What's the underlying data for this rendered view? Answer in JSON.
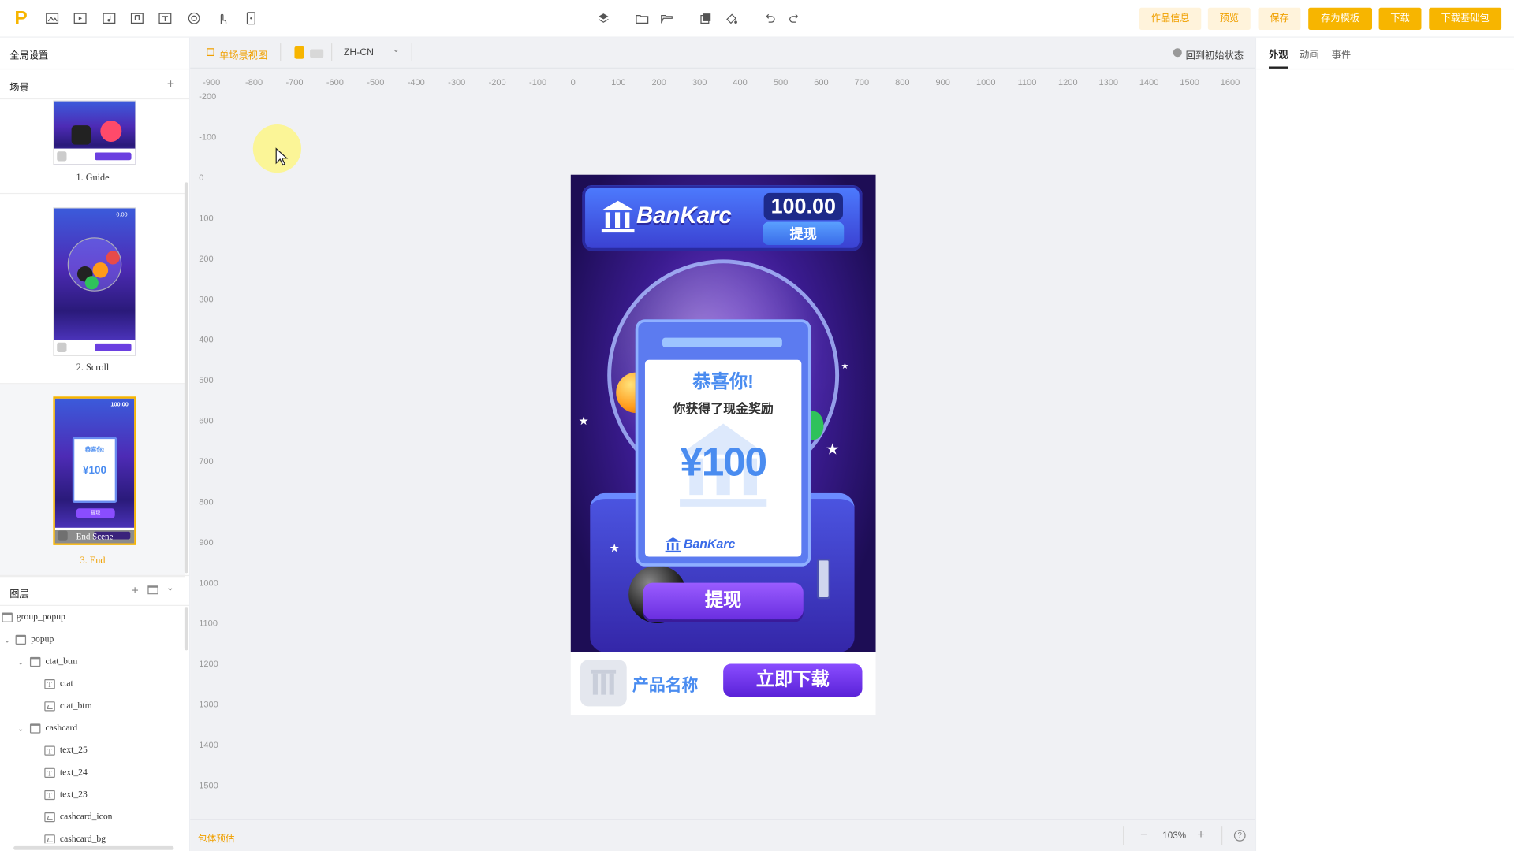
{
  "toolbar": {
    "left_icons": [
      "image-icon",
      "video-icon",
      "music-note-icon",
      "audio-icon",
      "text-icon",
      "target-icon",
      "gesture-icon",
      "phone-icon"
    ],
    "center_icons": [
      "layers-icon",
      "folder-icon",
      "folder-open-icon",
      "copy-icon",
      "paint-icon",
      "undo-icon",
      "redo-icon"
    ],
    "buttons": {
      "info": "作品信息",
      "preview": "预览",
      "save": "保存",
      "save_template": "存为模板",
      "download": "下载",
      "download_base": "下载基础包"
    },
    "accent": "#f7b500"
  },
  "left": {
    "global_settings": "全局设置",
    "scenes_title": "场景",
    "scenes": [
      {
        "label": "1. Guide"
      },
      {
        "label": "2. Scroll"
      },
      {
        "label": "3. End",
        "overlay": "End Scene"
      }
    ],
    "thumbs": {
      "scroll_balance": "0.00",
      "end_balance": "100.00",
      "end_congrats": "恭喜你!",
      "end_amount": "¥100",
      "end_withdraw": "提现"
    },
    "layers_title": "图层",
    "layers": [
      {
        "name": "group_popup"
      },
      {
        "name": "popup"
      },
      {
        "name": "ctat_btm"
      },
      {
        "name": "ctat"
      },
      {
        "name": "ctat_btm"
      },
      {
        "name": "cashcard"
      },
      {
        "name": "text_25"
      },
      {
        "name": "text_24"
      },
      {
        "name": "text_23"
      },
      {
        "name": "cashcard_icon"
      },
      {
        "name": "cashcard_bg"
      }
    ]
  },
  "canvas_toolbar": {
    "single_view": "单场景视图",
    "language": "ZH-CN",
    "reset": "回到初始状态"
  },
  "ruler": {
    "h": [
      "-900",
      "-800",
      "-700",
      "-600",
      "-500",
      "-400",
      "-300",
      "-200",
      "-100",
      "0",
      "100",
      "200",
      "300",
      "400",
      "500",
      "600",
      "700",
      "800",
      "900",
      "1000",
      "1100",
      "1200",
      "1300",
      "1400",
      "1500",
      "1600"
    ],
    "v": [
      "-200",
      "-100",
      "0",
      "100",
      "200",
      "300",
      "400",
      "500",
      "600",
      "700",
      "800",
      "900",
      "1000",
      "1100",
      "1200",
      "1300",
      "1400",
      "1500"
    ]
  },
  "creative": {
    "brand": "BanKarc",
    "balance": "100.00",
    "withdraw_header": "提现",
    "card_title": "恭喜你!",
    "card_subtitle": "你获得了现金奖励",
    "card_amount": "¥100",
    "card_logo": "BanKarc",
    "withdraw_button": "提现",
    "cta_name": "产品名称",
    "cta_button": "立即下载"
  },
  "right": {
    "tabs": [
      "外观",
      "动画",
      "事件"
    ],
    "active_tab": "外观"
  },
  "bottom": {
    "package_estimate": "包体预估",
    "zoom": "103%"
  }
}
